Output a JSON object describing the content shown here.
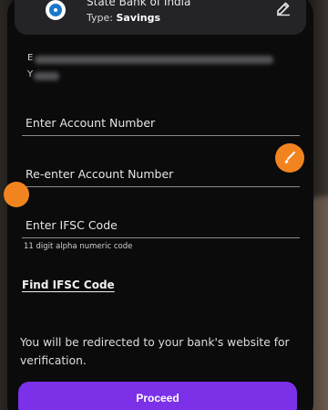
{
  "bank": {
    "name": "State Bank of India",
    "type_label": "Type:",
    "type_value": "Savings",
    "logo_icon": "bank-logo-icon",
    "edit_icon": "edit-pencil-icon"
  },
  "blurred_info": {
    "line1_prefix": "E",
    "line2_prefix": "Y"
  },
  "form": {
    "account_number_label": "Enter Account Number",
    "reenter_account_label": "Re-enter Account Number",
    "ifsc_label": "Enter IFSC Code",
    "ifsc_helper": "11 digit alpha numeric code"
  },
  "find_ifsc_link": "Find IFSC Code",
  "notice": "You will be redirected to your bank's website for verification.",
  "proceed_button": "Proceed",
  "colors": {
    "accent": "#7c31e8",
    "floating_button": "#f28420",
    "background": "#0b0b0c"
  }
}
